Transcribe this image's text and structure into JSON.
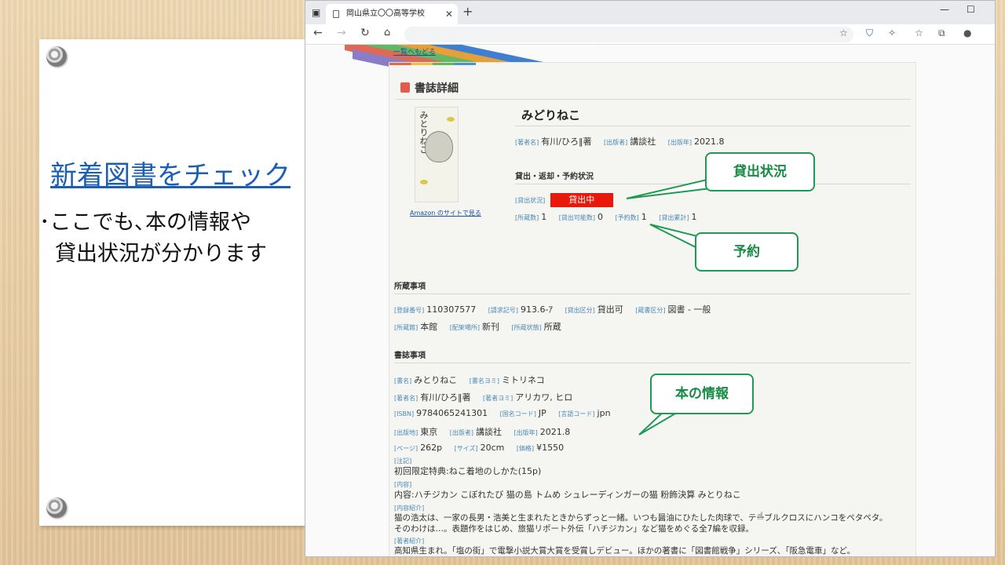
{
  "slide": {
    "heading": "新着図書をチェック",
    "bullet_line1": "･ここでも､本の情報や",
    "bullet_line2": "貸出状況が分かります"
  },
  "browser": {
    "tab_title": "岡山県立〇〇高等学校",
    "back_link": "一覧へもどる",
    "section_title": "書誌詳細",
    "book_title": "みどりねこ",
    "cover_title": "みとりねこ",
    "amazon_link": "Amazon のサイトで見る",
    "meta": {
      "author_label": "[著者名]",
      "author": "有川/ひろ‖著",
      "publisher_label": "[出版者]",
      "publisher": "講談社",
      "year_label": "[出版年]",
      "year": "2021.8"
    },
    "loan": {
      "heading": "貸出・返却・予約状況",
      "status_label": "[貸出状況]",
      "status": "貸出中",
      "owned_label": "[所蔵数]",
      "owned": "1",
      "avail_label": "[貸出可能数]",
      "avail": "0",
      "reserve_label": "[予約数]",
      "reserve": "1",
      "total_label": "[貸出累計]",
      "total": "1"
    },
    "holding": {
      "heading": "所蔵事項",
      "reg_label": "[登録番号]",
      "reg": "110307577",
      "call_label": "[請求記号]",
      "call": "913.6-ｱ",
      "loanclass_label": "[貸出区分]",
      "loanclass": "貸出可",
      "category_label": "[蔵書区分]",
      "category": "図書 - 一般",
      "location_label": "[所蔵館]",
      "location": "本館",
      "shelf_label": "[配架場所]",
      "shelf": "新刊",
      "state_label": "[所蔵状態]",
      "state": "所蔵"
    },
    "biblio": {
      "heading": "書誌事項",
      "title_label": "[書名]",
      "title": "みとりねこ",
      "yomi_label": "[書名ヨミ]",
      "yomi": "ミトリネコ",
      "author_label": "[著者名]",
      "author": "有川/ひろ‖著",
      "author_yomi_label": "[著者ヨミ]",
      "author_yomi": "アリカワ, ヒロ",
      "isbn_label": "[ISBN]",
      "isbn": "9784065241301",
      "country_label": "[国名コード]",
      "country": "JP",
      "lang_label": "[言語コード]",
      "lang": "jpn",
      "place_label": "[出版地]",
      "place": "東京",
      "publisher_label": "[出版者]",
      "publisher": "講談社",
      "year_label": "[出版年]",
      "year": "2021.8",
      "pages_label": "[ページ]",
      "pages": "262p",
      "size_label": "[サイズ]",
      "size": "20cm",
      "price_label": "[価格]",
      "price": "¥1550",
      "note_label": "[注記]",
      "note": "初回限定特典:ねこ着地のしかた(15p)",
      "contents_label": "[内容]",
      "contents": "内容:ハチジカン こぼれたび 猫の島 トムめ シュレーディンガーの猫 粉飾決算 みとりねこ",
      "intro_label": "[内容紹介]",
      "intro_line1": "猫の浩太は、一家の長男・浩美と生まれたときからずっと一緒。いつも醤油にひたした肉球で、テーブルクロスにハンコをペタペタ。",
      "intro_line2": "そのわけは…。表題作をはじめ、旅猫リポート外伝「ハチジカン」など猫をめぐる全7編を収録。",
      "author_intro_label": "[著者紹介]",
      "author_intro": "高知県生まれ。「塩の街」で電撃小説大賞大賞を受賞しデビュー。ほかの著書に「図書館戦争」シリーズ、「阪急電車」など。"
    }
  },
  "callouts": {
    "loan_status": "貸出状況",
    "reservation": "予約",
    "book_info": "本の情報"
  },
  "colors": {
    "status_red": "#e8190c",
    "callout_green": "#1f9a52",
    "heading_blue": "#1a5fb4"
  }
}
